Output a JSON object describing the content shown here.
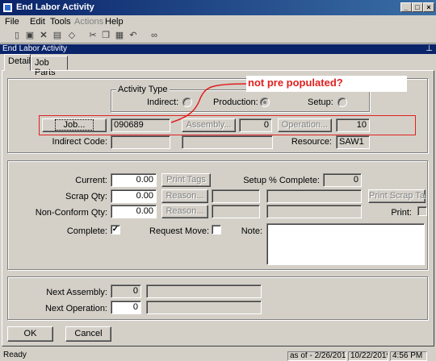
{
  "window": {
    "title": "End Labor Activity"
  },
  "menu": [
    "File",
    "Edit",
    "Tools",
    "Actions",
    "Help"
  ],
  "panel_title": "End Labor Activity",
  "tabs": [
    "Detail",
    "Job Parts"
  ],
  "annotation": {
    "text": "not pre populated?"
  },
  "activity_type": {
    "title": "Activity Type",
    "indirect_label": "Indirect:",
    "production_label": "Production:",
    "setup_label": "Setup:",
    "selected": "Production"
  },
  "job_row": {
    "job_button": "Job...",
    "job_value": "090689",
    "assembly_button": "Assembly...",
    "assembly_value": "0",
    "operation_button": "Operation...",
    "operation_value": "10"
  },
  "indirect_row": {
    "indirect_code_label": "Indirect Code:",
    "resource_label": "Resource:",
    "resource_value": "SAW1"
  },
  "quantities": {
    "current_label": "Current:",
    "current_value": "0.00",
    "print_tags": "Print Tags",
    "setup_complete_label": "Setup % Complete:",
    "setup_complete_value": "0",
    "scrap_label": "Scrap Qty:",
    "scrap_value": "0.00",
    "reason_button": "Reason...",
    "print_scrap_tags": "Print Scrap Ta",
    "nonconform_label": "Non-Conform Qty:",
    "nonconform_value": "0.00",
    "reason_button2": "Reason...",
    "print_label": "Print:",
    "complete_label": "Complete:",
    "complete_checked": true,
    "request_move_label": "Request Move:",
    "request_move_checked": false,
    "note_label": "Note:",
    "note_value": ""
  },
  "next": {
    "assembly_label": "Next Assembly:",
    "assembly_value": "0",
    "operation_label": "Next Operation:",
    "operation_value": "0"
  },
  "buttons": {
    "ok": "OK",
    "cancel": "Cancel"
  },
  "status": {
    "ready": "Ready",
    "as_of": "as of - 2/26/2019",
    "date": "10/22/2019",
    "time": "4:56 PM"
  },
  "colors": {
    "titlebar": "#0a246a",
    "annotation": "#e02020",
    "face": "#d4d0c8"
  }
}
